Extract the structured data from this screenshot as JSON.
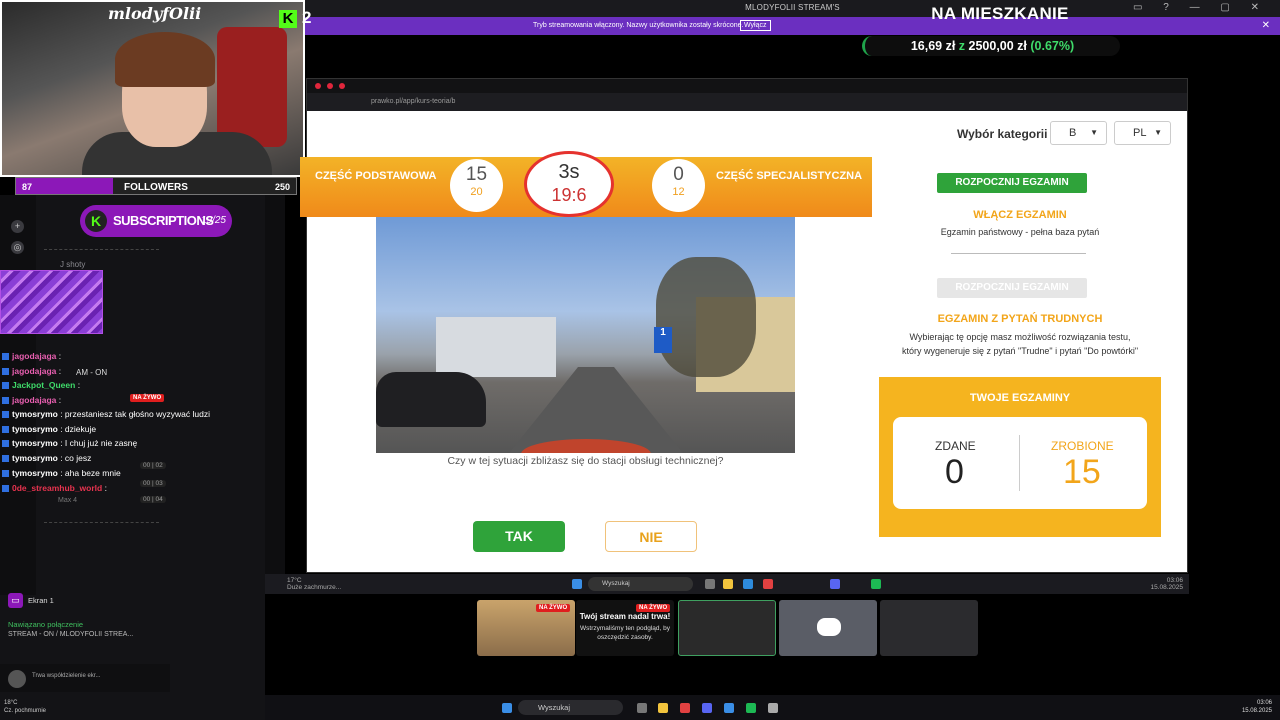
{
  "overlay": {
    "streamer_name": "mlodyfOlii",
    "kick_count": "2",
    "followers": {
      "current": "87",
      "label": "FOLLOWERS",
      "goal": "250",
      "progress": 0.348
    },
    "subscriptions": {
      "label": "SUBSCRIPTIONS",
      "count": "19/25"
    },
    "heading": "NA MIESZKANIE",
    "goal_text": {
      "raised": "16,69 zł",
      "word": "z",
      "target": "2500,00 zł",
      "pct": "(0.67%)"
    }
  },
  "window": {
    "title": "MLODYFOLII STREAM'S",
    "banner_text": "Tryb streamowania włączony. Nazwy użytkownika zostały skrócone.",
    "banner_button": "Wyłącz"
  },
  "discord": {
    "channels": [
      "J shoty"
    ],
    "user_row": "AM - ON",
    "chat": [
      {
        "user": "jagodajaga",
        "text": ":",
        "color": "#e85fb0"
      },
      {
        "user": "jagodajaga",
        "text": ":",
        "color": "#e85fb0"
      },
      {
        "user": "Jackpot_Queen",
        "text": ":",
        "color": "#3fdb6a"
      },
      {
        "user": "jagodajaga",
        "text": ":",
        "color": "#e85fb0"
      },
      {
        "user": "tymosrymo",
        "text": ": przestaniesz tak głośno wyzywać ludzi",
        "color": "#ffffff"
      },
      {
        "user": "tymosrymo",
        "text": ": dziekuje",
        "color": "#ffffff"
      },
      {
        "user": "tymosrymo",
        "text": ": I chuj już nie zasnę",
        "color": "#ffffff"
      },
      {
        "user": "tymosrymo",
        "text": ": co jesz",
        "color": "#ffffff"
      },
      {
        "user": "tymosrymo",
        "text": ": aha beze mnie",
        "color": "#ffffff"
      },
      {
        "user": "0de_streamhub_world",
        "text": ":",
        "color": "#e8334f"
      }
    ],
    "live_badge": "NA ŻYWO",
    "max_list": [
      "Max 4"
    ],
    "badges": [
      "00 | 02",
      "00 | 03",
      "00 | 04"
    ],
    "screen_label": "Ekran 1",
    "connection": "Nawiązano połączenie",
    "connection_sub": "STREAM - ON / MLODYFOLII STREA...",
    "sharing": "Trwa współdzielenie ekr..."
  },
  "browser": {
    "url": "prawko.pl/app/kurs-teoria/b"
  },
  "page": {
    "category_label": "Wybór kategorii",
    "category_value": "B",
    "lang_value": "PL",
    "basic_part": "CZĘŚĆ PODSTAWOWA",
    "basic_done": "15",
    "basic_total": "20",
    "timer_seconds": "3s",
    "timer_code": "19:6",
    "special_done": "0",
    "special_total": "12",
    "special_part": "CZĘŚĆ SPECJALISTYCZNA",
    "question": "Czy w tej sytuacji zbliżasz się do stacji obsługi technicznej?",
    "sign_number": "1",
    "yes": "TAK",
    "no": "NIE",
    "start_exam": "ROZPOCZNIJ EGZAMIN",
    "enable_exam": "WŁĄCZ EGZAMIN",
    "enable_exam_desc": "Egzamin państwowy - pełna baza pytań",
    "start_exam_disabled": "ROZPOCZNIJ EGZAMIN",
    "hard_exam": "EGZAMIN Z PYTAŃ TRUDNYCH",
    "hard_exam_desc": "Wybierając tę opcję masz możliwość rozwiązania testu, który wygeneruje się z pytań \"Trudne\" i pytań \"Do powtórki\"",
    "your_exams": "TWOJE EGZAMINY",
    "passed_label": "ZDANE",
    "passed_value": "0",
    "done_label": "ZROBIONE",
    "done_value": "15"
  },
  "taskbar": {
    "search": "Wyszukaj",
    "inner_search": "Wyszukaj",
    "weather_temp": "18°C",
    "weather_desc": "Cz. pochmurnie",
    "inner_weather_temp": "17°C",
    "inner_weather_desc": "Duże zachmurze...",
    "time": "03:06",
    "date": "15.08.2025",
    "inner_time": "03:06",
    "inner_date": "15.08.2025"
  },
  "previews": {
    "live": "NA ŻYWO",
    "stream_title": "Twój stream nadal trwa!",
    "stream_desc": "Wstrzymaliśmy ten podgląd, by oszczędzić zasoby."
  }
}
